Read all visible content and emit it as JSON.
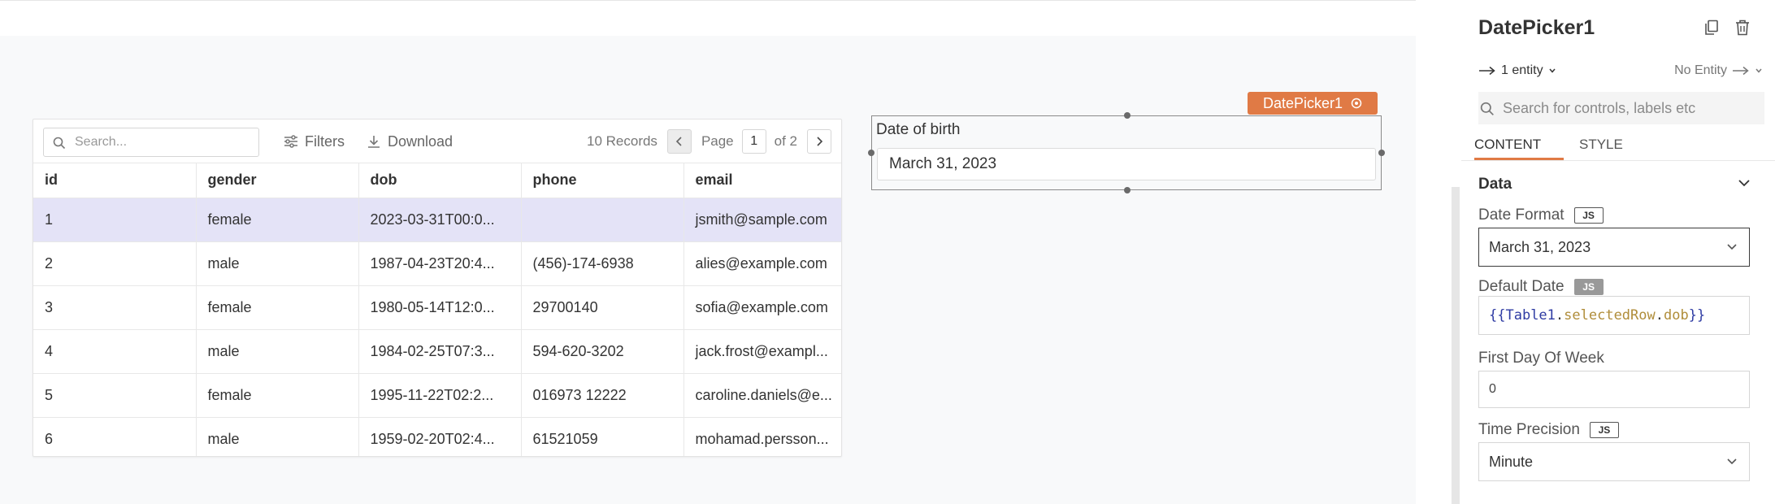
{
  "table": {
    "search_placeholder": "Search...",
    "filters_label": "Filters",
    "download_label": "Download",
    "records_text": "10 Records",
    "page_label": "Page",
    "page_number": "1",
    "page_total": "of 2",
    "columns": [
      "id",
      "gender",
      "dob",
      "phone",
      "email"
    ],
    "rows": [
      [
        "1",
        "female",
        "2023-03-31T00:0...",
        "",
        "jsmith@sample.com"
      ],
      [
        "2",
        "male",
        "1987-04-23T20:4...",
        "(456)-174-6938",
        "alies@example.com"
      ],
      [
        "3",
        "female",
        "1980-05-14T12:0...",
        "29700140",
        "sofia@example.com"
      ],
      [
        "4",
        "male",
        "1984-02-25T07:3...",
        "594-620-3202",
        "jack.frost@exampl..."
      ],
      [
        "5",
        "female",
        "1995-11-22T02:2...",
        "016973 12222",
        "caroline.daniels@e..."
      ],
      [
        "6",
        "male",
        "1959-02-20T02:4...",
        "61521059",
        "mohamad.persson..."
      ]
    ]
  },
  "datepicker": {
    "tag": "DatePicker1",
    "label": "Date of birth",
    "value": "March 31, 2023"
  },
  "pane": {
    "title": "DatePicker1",
    "entity_left": "1 entity",
    "entity_right": "No Entity",
    "search_placeholder": "Search for controls, labels etc",
    "tabs": [
      "CONTENT",
      "STYLE"
    ],
    "section": "Data",
    "js_label": "JS",
    "date_format": {
      "label": "Date Format",
      "value": "March 31, 2023"
    },
    "default_date": {
      "label": "Default Date",
      "open": "{{",
      "ident": "Table1",
      "dot1": ".",
      "prop1": "selectedRow",
      "dot2": ".",
      "prop2": "dob",
      "close": "}}"
    },
    "first_day": {
      "label": "First Day Of Week",
      "value": "0"
    },
    "time_precision": {
      "label": "Time Precision",
      "value": "Minute"
    }
  },
  "colors": {
    "accent": "#e07a45",
    "selected_row": "#e4e3f7",
    "canvas": "#f8f9fa"
  },
  "icons": [
    "search-icon",
    "filter-icon",
    "download-icon",
    "chevron-left-icon",
    "chevron-right-icon",
    "close-icon",
    "copy-icon",
    "trash-icon",
    "arrow-right-icon",
    "chevron-down-icon"
  ]
}
